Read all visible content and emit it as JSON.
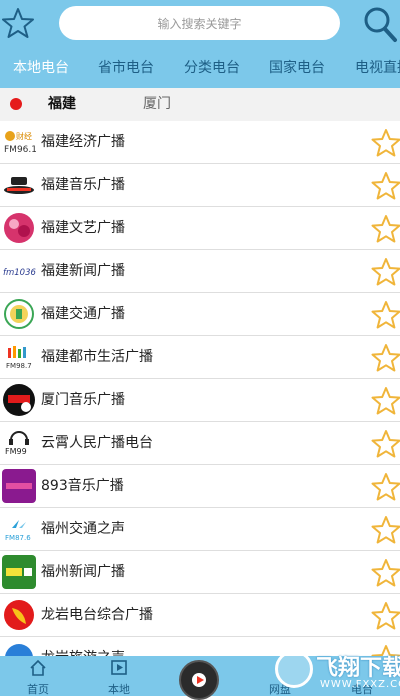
{
  "search": {
    "placeholder": "输入搜索关键字"
  },
  "tabs": [
    {
      "label": "本地电台",
      "active": true
    },
    {
      "label": "省市电台",
      "active": false
    },
    {
      "label": "分类电台",
      "active": false
    },
    {
      "label": "国家电台",
      "active": false
    },
    {
      "label": "电视直播",
      "active": false
    }
  ],
  "region": {
    "province": "福建",
    "city": "厦门"
  },
  "stations": [
    {
      "name": "福建经济广播",
      "logo_text": "FM96.1"
    },
    {
      "name": "福建音乐广播",
      "logo_text": ""
    },
    {
      "name": "福建文艺广播",
      "logo_text": ""
    },
    {
      "name": "福建新闻广播",
      "logo_text": "fm1036"
    },
    {
      "name": "福建交通广播",
      "logo_text": ""
    },
    {
      "name": "福建都市生活广播",
      "logo_text": "FM98.7"
    },
    {
      "name": "厦门音乐广播",
      "logo_text": ""
    },
    {
      "name": "云霄人民广播电台",
      "logo_text": "FM99"
    },
    {
      "name": "893音乐广播",
      "logo_text": ""
    },
    {
      "name": "福州交通之声",
      "logo_text": "FM87.6"
    },
    {
      "name": "福州新闻广播",
      "logo_text": ""
    },
    {
      "name": "龙岩电台综合广播",
      "logo_text": ""
    },
    {
      "name": "龙岩旅游之声",
      "logo_text": ""
    }
  ],
  "bottom_nav": [
    {
      "label": "首页",
      "icon": "home-icon"
    },
    {
      "label": "本地",
      "icon": "play-square-icon"
    },
    {
      "label": "网盘",
      "icon": "cloud-icon"
    },
    {
      "label": "电台",
      "icon": "radio-icon"
    }
  ],
  "watermark": {
    "title": "飞翔下载",
    "url": "WWW.FXXZ.COM"
  },
  "colors": {
    "bar": "#7cc8ea",
    "star": "#f0b53a",
    "active_tab": "#ffffff",
    "tab": "#1e5f86"
  }
}
